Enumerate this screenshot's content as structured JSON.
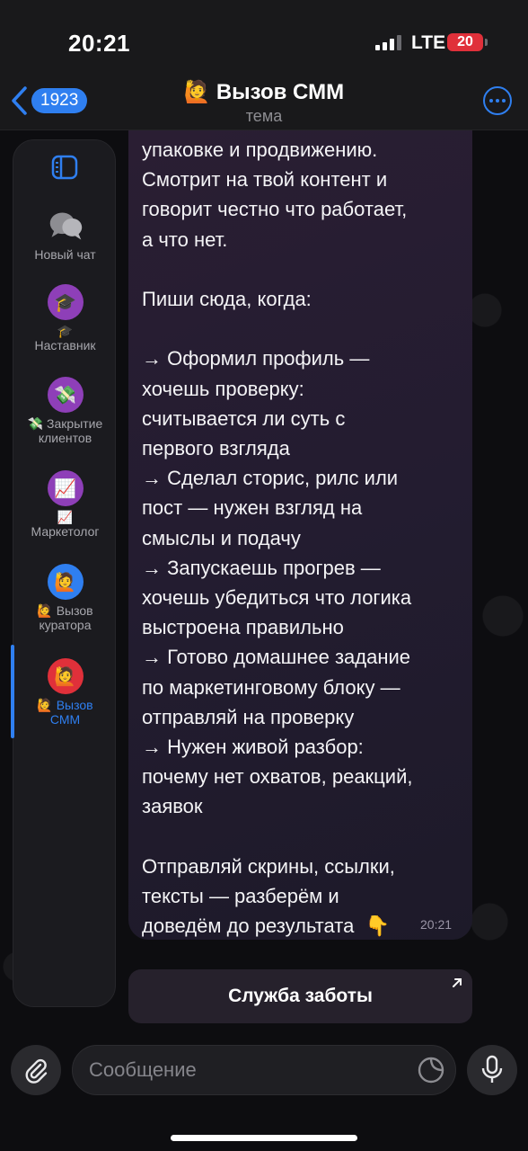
{
  "status_bar": {
    "time": "20:21",
    "network": "LTE",
    "battery": "20",
    "battery_color": "#e0303a"
  },
  "header": {
    "back_count": "1923",
    "title_emoji": "🙋",
    "title": "Вызов СММ",
    "subtitle": "тема",
    "accent_color": "#2f7ff0"
  },
  "sidebar": {
    "toggle_icon": "sidebar-panel-icon",
    "items": [
      {
        "id": "new-chat",
        "emoji": "💬",
        "label": "Новый чат",
        "color": "transparent"
      },
      {
        "id": "mentor",
        "emoji": "🎓",
        "label": "🎓\nНаставник",
        "color": "#8e3fb8"
      },
      {
        "id": "closing-clients",
        "emoji": "💸",
        "label": "💸 Закрытие\nклиентов",
        "color": "#8e3fb8"
      },
      {
        "id": "marketer",
        "emoji": "📈",
        "label": "📈\nМаркетолог",
        "color": "#8e3fb8"
      },
      {
        "id": "curator-call",
        "emoji": "🙋",
        "label": "🙋 Вызов\nкуратора",
        "color": "#2f7ff0"
      },
      {
        "id": "smm-call",
        "emoji": "🙋",
        "label": "🙋 Вызов\nСММ",
        "color": "#e0303a",
        "active": true
      }
    ]
  },
  "message": {
    "text": "упаковке и продвижению.\nСмотрит на твой контент и\nговорит честно что работает,\nа что нет.\n\nПиши сюда, когда:\n\n→ Оформил профиль —\nхочешь проверку:\nсчитывается ли суть с\nпервого взгляда\n→ Сделал сторис, рилс или\nпост — нужен взгляд на\nсмыслы и подачу\n→ Запускаешь прогрев —\nхочешь убедиться что логика\nвыстроена правильно\n→ Готово домашнее задание\nпо маркетинговому блоку —\nотправляй на проверку\n→ Нужен живой разбор:\nпочему нет охватов, реакций,\nзаявок\n\nОтправляй скрины, ссылки,\nтексты — разберём и\nдоведём до результата  👇",
    "time": "20:21"
  },
  "inline_button": {
    "label": "Служба заботы"
  },
  "composer": {
    "placeholder": "Сообщение"
  }
}
